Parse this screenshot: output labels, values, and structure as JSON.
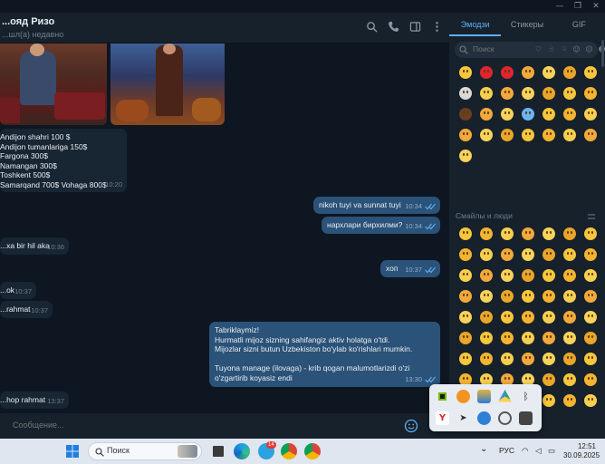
{
  "window": {
    "controls": [
      "—",
      "❐",
      "✕"
    ]
  },
  "chat": {
    "name": "...ояд Ризо",
    "status": "...шл(а) недавно",
    "messages": [
      {
        "dir": "in",
        "lines": [
          "Andijon shahri 100 $",
          "Andijon tumanlariga 150$",
          "Fargona 300$",
          "Namangan 300$",
          "Toshkent 500$",
          "Samarqand 700$ Vohaga 800$"
        ],
        "time": "10:20"
      },
      {
        "dir": "out",
        "lines": [
          "nikoh tuyi va sunnat tuyi"
        ],
        "time": "10:34"
      },
      {
        "dir": "out",
        "lines": [
          "нархлари бирхилми?"
        ],
        "time": "10:34"
      },
      {
        "dir": "in",
        "lines": [
          "...xa bir hil aka"
        ],
        "time": "10:36"
      },
      {
        "dir": "out",
        "lines": [
          "хоп"
        ],
        "time": "10:37"
      },
      {
        "dir": "in",
        "lines": [
          "...ok"
        ],
        "time": "10:37"
      },
      {
        "dir": "in",
        "lines": [
          "...rahmat"
        ],
        "time": "10:37"
      },
      {
        "dir": "out",
        "lines": [
          "Tabriklaymiz!",
          "Hurmatli mijoz sizning sahifangiz aktiv holatga o'tdi.",
          "Mijozlar sizni butun Uzbekiston bo'ylab ko'rishlari mumkin.",
          "",
          "Tuyona manage (ilovaga) - krib qogan malumotlarizdi o'zi",
          "o'zgartirib koyasiz endi"
        ],
        "time": "13:30"
      },
      {
        "dir": "in",
        "lines": [
          "...hop rahmat"
        ],
        "time": "13:37"
      }
    ],
    "composer_placeholder": "Сообщение..."
  },
  "emoji_panel": {
    "tabs": [
      "Эмодзи",
      "Стикеры",
      "GIF"
    ],
    "active_tab": "Эмодзи",
    "search_placeholder": "Поиск",
    "section_label": "Смайлы и люди"
  },
  "taskbar": {
    "search_text": "Поиск",
    "language": "РУС",
    "time": "12:51",
    "date": "30.09.2025",
    "telegram_badge": "14"
  },
  "colors": {
    "chat_bg": "#0e1621",
    "header_bg": "#17212b",
    "bubble_in": "#182533",
    "bubble_out": "#2b5278",
    "accent": "#5fb0f2",
    "taskbar_bg": "#dfe6ef"
  }
}
